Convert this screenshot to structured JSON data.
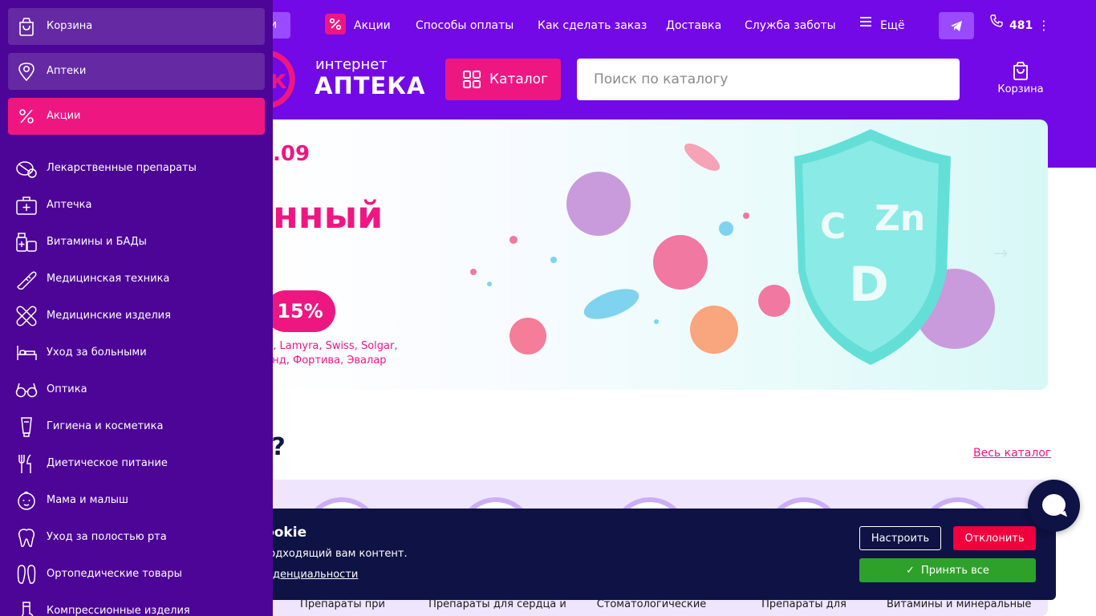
{
  "colors": {
    "header_bg": "#7209e6",
    "sidebar_bg": "#4d0597",
    "accent_pink": "#ee1782",
    "cookie_bg": "#0e1244",
    "reject_red": "#f0003c",
    "accept_green": "#2ea12a",
    "category_strip_bg": "#efe6fd"
  },
  "header": {
    "nav_pill_label": "и",
    "nav": [
      {
        "label": "Акции",
        "icon": "percent-icon"
      },
      {
        "label": "Способы оплаты"
      },
      {
        "label": "Как сделать заказ"
      },
      {
        "label": "Доставка"
      },
      {
        "label": "Служба заботы"
      },
      {
        "label": "Ещё",
        "icon": "menu-icon"
      }
    ],
    "telegram_icon": "telegram-icon",
    "phone": "481",
    "logo_small": "интернет",
    "logo_big": "АПТЕКА",
    "catalog_label": "Каталог",
    "search_placeholder": "Поиск по каталогу",
    "cart_label": "Корзина"
  },
  "banner": {
    "date": ".09",
    "title": "нный",
    "discount": "15%",
    "brands_line1": "rum, Lamyra, Swiss, Solgar,",
    "brands_line2": "млэнд, Фортива, Эвалар",
    "shield_letters": [
      "C",
      "Zn",
      "D"
    ]
  },
  "section": {
    "title": "ит?",
    "all_catalog": "Весь каталог",
    "categories": [
      {
        "label": "Препараты при"
      },
      {
        "label": "Препараты для сердца и"
      },
      {
        "label": "Стоматологические"
      },
      {
        "label": "Препараты для"
      },
      {
        "label": "Витамины и минеральные"
      }
    ]
  },
  "cookie": {
    "title": "cookie",
    "text": "ь подходящий вам контент.",
    "link": "денциальности",
    "configure": "Настроить",
    "reject": "Отклонить",
    "accept": "Принять все"
  },
  "sidebar": {
    "top": [
      {
        "label": "Корзина",
        "icon": "bag-icon"
      },
      {
        "label": "Аптеки",
        "icon": "location-pin-icon"
      },
      {
        "label": "Акции",
        "icon": "percent-icon",
        "active": true
      }
    ],
    "categories": [
      {
        "label": "Лекарственные препараты",
        "icon": "pills-icon"
      },
      {
        "label": "Аптечка",
        "icon": "first-aid-kit-icon"
      },
      {
        "label": "Витамины и БАДы",
        "icon": "vitamins-icon"
      },
      {
        "label": "Медицинская техника",
        "icon": "thermometer-icon"
      },
      {
        "label": "Медицинские изделия",
        "icon": "bandage-icon"
      },
      {
        "label": "Уход за больными",
        "icon": "hospital-bed-icon"
      },
      {
        "label": "Оптика",
        "icon": "glasses-icon"
      },
      {
        "label": "Гигиена и косметика",
        "icon": "cosmetics-tube-icon"
      },
      {
        "label": "Диетическое питание",
        "icon": "fork-knife-icon"
      },
      {
        "label": "Мама и малыш",
        "icon": "baby-face-icon"
      },
      {
        "label": "Уход за полостью рта",
        "icon": "tooth-icon"
      },
      {
        "label": "Ортопедические товары",
        "icon": "insoles-icon"
      },
      {
        "label": "Компрессионные изделия",
        "icon": "compression-stocking-icon"
      }
    ]
  }
}
